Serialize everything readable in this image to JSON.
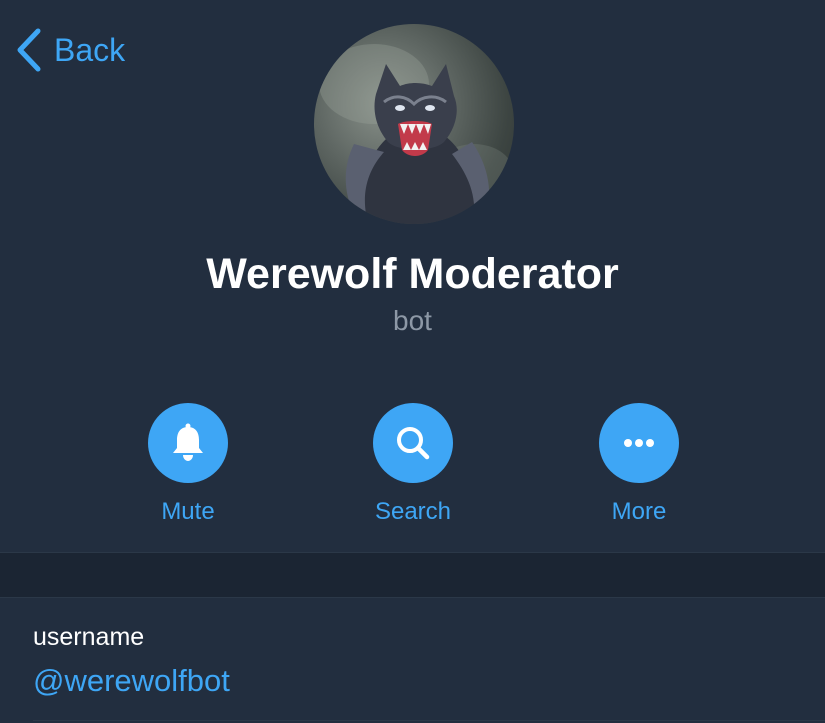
{
  "nav": {
    "back_label": "Back"
  },
  "profile": {
    "name": "Werewolf Moderator",
    "subtitle": "bot",
    "avatar_icon": "werewolf-avatar"
  },
  "actions": [
    {
      "label": "Mute",
      "icon": "bell-icon"
    },
    {
      "label": "Search",
      "icon": "search-icon"
    },
    {
      "label": "More",
      "icon": "more-icon"
    }
  ],
  "info": {
    "username_label": "username",
    "username_value": "@werewolfbot"
  },
  "colors": {
    "background": "#222e3f",
    "accent": "#3ea6f5",
    "secondary_text": "#8d98a6",
    "section_band": "#1b2533"
  }
}
